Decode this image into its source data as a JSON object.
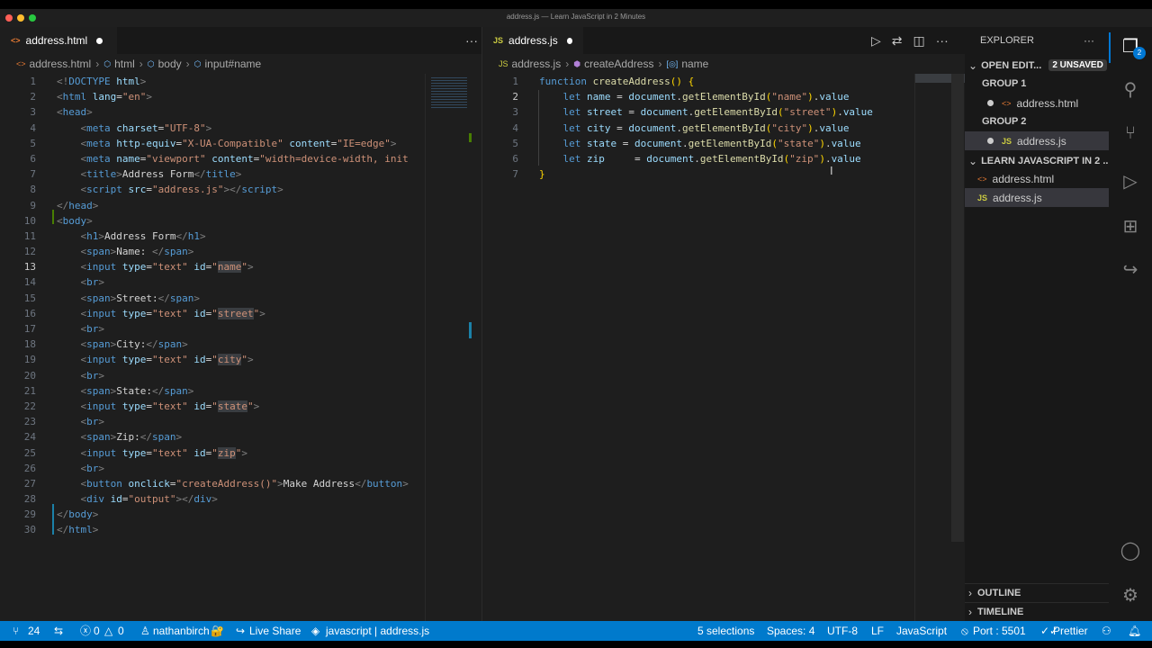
{
  "window": {
    "title": "address.js — Learn JavaScript in 2 Minutes",
    "colors": {
      "red": "#fe5f57",
      "yellow": "#febc2e",
      "green": "#28c840"
    }
  },
  "left_editor": {
    "tab_label": "address.html",
    "tab_icon": "html-file-icon",
    "more": "···",
    "breadcrumb": [
      "address.html",
      "html",
      "body",
      "input#name"
    ],
    "lines": [
      [
        [
          "t-gray",
          "<!"
        ],
        [
          "t-tag",
          "DOCTYPE"
        ],
        [
          "t-attr",
          " html"
        ],
        [
          "t-gray",
          ">"
        ]
      ],
      [
        [
          "t-gray",
          "<"
        ],
        [
          "t-tag",
          "html"
        ],
        [
          "t-attr",
          " lang"
        ],
        [
          "t-text",
          "="
        ],
        [
          "t-str",
          "\"en\""
        ],
        [
          "t-gray",
          ">"
        ]
      ],
      [
        [
          "t-gray",
          "<"
        ],
        [
          "t-tag",
          "head"
        ],
        [
          "t-gray",
          ">"
        ]
      ],
      [
        [
          "t-text",
          "    "
        ],
        [
          "t-gray",
          "<"
        ],
        [
          "t-tag",
          "meta"
        ],
        [
          "t-attr",
          " charset"
        ],
        [
          "t-text",
          "="
        ],
        [
          "t-str",
          "\"UTF-8\""
        ],
        [
          "t-gray",
          ">"
        ]
      ],
      [
        [
          "t-text",
          "    "
        ],
        [
          "t-gray",
          "<"
        ],
        [
          "t-tag",
          "meta"
        ],
        [
          "t-attr",
          " http-equiv"
        ],
        [
          "t-text",
          "="
        ],
        [
          "t-str",
          "\"X-UA-Compatible\""
        ],
        [
          "t-attr",
          " content"
        ],
        [
          "t-text",
          "="
        ],
        [
          "t-str",
          "\"IE=edge\""
        ],
        [
          "t-gray",
          ">"
        ]
      ],
      [
        [
          "t-text",
          "    "
        ],
        [
          "t-gray",
          "<"
        ],
        [
          "t-tag",
          "meta"
        ],
        [
          "t-attr",
          " name"
        ],
        [
          "t-text",
          "="
        ],
        [
          "t-str",
          "\"viewport\""
        ],
        [
          "t-attr",
          " content"
        ],
        [
          "t-text",
          "="
        ],
        [
          "t-str",
          "\"width=device-width, init"
        ]
      ],
      [
        [
          "t-text",
          "    "
        ],
        [
          "t-gray",
          "<"
        ],
        [
          "t-tag",
          "title"
        ],
        [
          "t-gray",
          ">"
        ],
        [
          "t-text",
          "Address Form"
        ],
        [
          "t-gray",
          "</"
        ],
        [
          "t-tag",
          "title"
        ],
        [
          "t-gray",
          ">"
        ]
      ],
      [
        [
          "t-text",
          "    "
        ],
        [
          "t-gray",
          "<"
        ],
        [
          "t-tag",
          "script"
        ],
        [
          "t-attr",
          " src"
        ],
        [
          "t-text",
          "="
        ],
        [
          "t-str",
          "\"address.js\""
        ],
        [
          "t-gray",
          "></"
        ],
        [
          "t-tag",
          "script"
        ],
        [
          "t-gray",
          ">"
        ]
      ],
      [
        [
          "t-gray",
          "</"
        ],
        [
          "t-tag",
          "head"
        ],
        [
          "t-gray",
          ">"
        ]
      ],
      [
        [
          "t-gray",
          "<"
        ],
        [
          "t-tag",
          "body"
        ],
        [
          "t-gray",
          ">"
        ]
      ],
      [
        [
          "t-text",
          "    "
        ],
        [
          "t-gray",
          "<"
        ],
        [
          "t-tag",
          "h1"
        ],
        [
          "t-gray",
          ">"
        ],
        [
          "t-text",
          "Address Form"
        ],
        [
          "t-gray",
          "</"
        ],
        [
          "t-tag",
          "h1"
        ],
        [
          "t-gray",
          ">"
        ]
      ],
      [
        [
          "t-text",
          "    "
        ],
        [
          "t-gray",
          "<"
        ],
        [
          "t-tag",
          "span"
        ],
        [
          "t-gray",
          ">"
        ],
        [
          "t-text",
          "Name: "
        ],
        [
          "t-gray",
          "</"
        ],
        [
          "t-tag",
          "span"
        ],
        [
          "t-gray",
          ">"
        ]
      ],
      [
        [
          "t-text",
          "    "
        ],
        [
          "t-gray",
          "<"
        ],
        [
          "t-tag",
          "input"
        ],
        [
          "t-attr",
          " type"
        ],
        [
          "t-text",
          "="
        ],
        [
          "t-str",
          "\"text\""
        ],
        [
          "t-attr",
          " id"
        ],
        [
          "t-text",
          "="
        ],
        [
          "t-str",
          "\""
        ],
        [
          "t-str hl",
          "name"
        ],
        [
          "t-str",
          "\""
        ],
        [
          "t-gray",
          ">"
        ]
      ],
      [
        [
          "t-text",
          "    "
        ],
        [
          "t-gray",
          "<"
        ],
        [
          "t-tag",
          "br"
        ],
        [
          "t-gray",
          ">"
        ]
      ],
      [
        [
          "t-text",
          "    "
        ],
        [
          "t-gray",
          "<"
        ],
        [
          "t-tag",
          "span"
        ],
        [
          "t-gray",
          ">"
        ],
        [
          "t-text",
          "Street:"
        ],
        [
          "t-gray",
          "</"
        ],
        [
          "t-tag",
          "span"
        ],
        [
          "t-gray",
          ">"
        ]
      ],
      [
        [
          "t-text",
          "    "
        ],
        [
          "t-gray",
          "<"
        ],
        [
          "t-tag",
          "input"
        ],
        [
          "t-attr",
          " type"
        ],
        [
          "t-text",
          "="
        ],
        [
          "t-str",
          "\"text\""
        ],
        [
          "t-attr",
          " id"
        ],
        [
          "t-text",
          "="
        ],
        [
          "t-str",
          "\""
        ],
        [
          "t-str hl",
          "street"
        ],
        [
          "t-str",
          "\""
        ],
        [
          "t-gray",
          ">"
        ]
      ],
      [
        [
          "t-text",
          "    "
        ],
        [
          "t-gray",
          "<"
        ],
        [
          "t-tag",
          "br"
        ],
        [
          "t-gray",
          ">"
        ]
      ],
      [
        [
          "t-text",
          "    "
        ],
        [
          "t-gray",
          "<"
        ],
        [
          "t-tag",
          "span"
        ],
        [
          "t-gray",
          ">"
        ],
        [
          "t-text",
          "City:"
        ],
        [
          "t-gray",
          "</"
        ],
        [
          "t-tag",
          "span"
        ],
        [
          "t-gray",
          ">"
        ]
      ],
      [
        [
          "t-text",
          "    "
        ],
        [
          "t-gray",
          "<"
        ],
        [
          "t-tag",
          "input"
        ],
        [
          "t-attr",
          " type"
        ],
        [
          "t-text",
          "="
        ],
        [
          "t-str",
          "\"text\""
        ],
        [
          "t-attr",
          " id"
        ],
        [
          "t-text",
          "="
        ],
        [
          "t-str",
          "\""
        ],
        [
          "t-str hl",
          "city"
        ],
        [
          "t-str",
          "\""
        ],
        [
          "t-gray",
          ">"
        ]
      ],
      [
        [
          "t-text",
          "    "
        ],
        [
          "t-gray",
          "<"
        ],
        [
          "t-tag",
          "br"
        ],
        [
          "t-gray",
          ">"
        ]
      ],
      [
        [
          "t-text",
          "    "
        ],
        [
          "t-gray",
          "<"
        ],
        [
          "t-tag",
          "span"
        ],
        [
          "t-gray",
          ">"
        ],
        [
          "t-text",
          "State:"
        ],
        [
          "t-gray",
          "</"
        ],
        [
          "t-tag",
          "span"
        ],
        [
          "t-gray",
          ">"
        ]
      ],
      [
        [
          "t-text",
          "    "
        ],
        [
          "t-gray",
          "<"
        ],
        [
          "t-tag",
          "input"
        ],
        [
          "t-attr",
          " type"
        ],
        [
          "t-text",
          "="
        ],
        [
          "t-str",
          "\"text\""
        ],
        [
          "t-attr",
          " id"
        ],
        [
          "t-text",
          "="
        ],
        [
          "t-str",
          "\""
        ],
        [
          "t-str hl",
          "state"
        ],
        [
          "t-str",
          "\""
        ],
        [
          "t-gray",
          ">"
        ]
      ],
      [
        [
          "t-text",
          "    "
        ],
        [
          "t-gray",
          "<"
        ],
        [
          "t-tag",
          "br"
        ],
        [
          "t-gray",
          ">"
        ]
      ],
      [
        [
          "t-text",
          "    "
        ],
        [
          "t-gray",
          "<"
        ],
        [
          "t-tag",
          "span"
        ],
        [
          "t-gray",
          ">"
        ],
        [
          "t-text",
          "Zip:"
        ],
        [
          "t-gray",
          "</"
        ],
        [
          "t-tag",
          "span"
        ],
        [
          "t-gray",
          ">"
        ]
      ],
      [
        [
          "t-text",
          "    "
        ],
        [
          "t-gray",
          "<"
        ],
        [
          "t-tag",
          "input"
        ],
        [
          "t-attr",
          " type"
        ],
        [
          "t-text",
          "="
        ],
        [
          "t-str",
          "\"text\""
        ],
        [
          "t-attr",
          " id"
        ],
        [
          "t-text",
          "="
        ],
        [
          "t-str",
          "\""
        ],
        [
          "t-str hl",
          "zip"
        ],
        [
          "t-str",
          "\""
        ],
        [
          "t-gray",
          ">"
        ]
      ],
      [
        [
          "t-text",
          "    "
        ],
        [
          "t-gray",
          "<"
        ],
        [
          "t-tag",
          "br"
        ],
        [
          "t-gray",
          ">"
        ]
      ],
      [
        [
          "t-text",
          "    "
        ],
        [
          "t-gray",
          "<"
        ],
        [
          "t-tag",
          "button"
        ],
        [
          "t-attr",
          " onclick"
        ],
        [
          "t-text",
          "="
        ],
        [
          "t-str",
          "\"createAddress()\""
        ],
        [
          "t-gray",
          ">"
        ],
        [
          "t-text",
          "Make Address"
        ],
        [
          "t-gray",
          "</"
        ],
        [
          "t-tag",
          "button"
        ],
        [
          "t-gray",
          ">"
        ]
      ],
      [
        [
          "t-text",
          "    "
        ],
        [
          "t-gray",
          "<"
        ],
        [
          "t-tag",
          "div"
        ],
        [
          "t-attr",
          " id"
        ],
        [
          "t-text",
          "="
        ],
        [
          "t-str",
          "\"output\""
        ],
        [
          "t-gray",
          "></"
        ],
        [
          "t-tag",
          "div"
        ],
        [
          "t-gray",
          ">"
        ]
      ],
      [
        [
          "t-gray",
          "</"
        ],
        [
          "t-tag",
          "body"
        ],
        [
          "t-gray",
          ">"
        ]
      ],
      [
        [
          "t-gray",
          "</"
        ],
        [
          "t-tag",
          "html"
        ],
        [
          "t-gray",
          ">"
        ]
      ]
    ],
    "current_line": 13
  },
  "right_editor": {
    "tab_label": "address.js",
    "tab_icon_text": "JS",
    "breadcrumb": [
      "address.js",
      "createAddress",
      "name"
    ],
    "actions": [
      "run-icon",
      "compare-icon",
      "split-editor-icon",
      "more-icon"
    ],
    "lines": [
      [
        [
          "t-kw",
          "function"
        ],
        [
          "t-text",
          " "
        ],
        [
          "t-fn",
          "createAddress"
        ],
        [
          "t-br",
          "()"
        ],
        [
          "t-text",
          " "
        ],
        [
          "t-br",
          "{"
        ]
      ],
      [
        [
          "t-text",
          "    "
        ],
        [
          "t-kw",
          "let"
        ],
        [
          "t-text",
          " "
        ],
        [
          "t-var",
          "name"
        ],
        [
          "t-text",
          " = "
        ],
        [
          "t-var",
          "document"
        ],
        [
          "t-text",
          "."
        ],
        [
          "t-fn",
          "getElementById"
        ],
        [
          "t-br",
          "("
        ],
        [
          "t-str",
          "\"name\""
        ],
        [
          "t-br",
          ")"
        ],
        [
          "t-text",
          "."
        ],
        [
          "t-var",
          "value"
        ]
      ],
      [
        [
          "t-text",
          "    "
        ],
        [
          "t-kw",
          "let"
        ],
        [
          "t-text",
          " "
        ],
        [
          "t-var",
          "street"
        ],
        [
          "t-text",
          " = "
        ],
        [
          "t-var",
          "document"
        ],
        [
          "t-text",
          "."
        ],
        [
          "t-fn",
          "getElementById"
        ],
        [
          "t-br",
          "("
        ],
        [
          "t-str",
          "\"street\""
        ],
        [
          "t-br",
          ")"
        ],
        [
          "t-text",
          "."
        ],
        [
          "t-var",
          "value"
        ]
      ],
      [
        [
          "t-text",
          "    "
        ],
        [
          "t-kw",
          "let"
        ],
        [
          "t-text",
          " "
        ],
        [
          "t-var",
          "city"
        ],
        [
          "t-text",
          " = "
        ],
        [
          "t-var",
          "document"
        ],
        [
          "t-text",
          "."
        ],
        [
          "t-fn",
          "getElementById"
        ],
        [
          "t-br",
          "("
        ],
        [
          "t-str",
          "\"city\""
        ],
        [
          "t-br",
          ")"
        ],
        [
          "t-text",
          "."
        ],
        [
          "t-var",
          "value"
        ]
      ],
      [
        [
          "t-text",
          "    "
        ],
        [
          "t-kw",
          "let"
        ],
        [
          "t-text",
          " "
        ],
        [
          "t-var",
          "state"
        ],
        [
          "t-text",
          " = "
        ],
        [
          "t-var",
          "document"
        ],
        [
          "t-text",
          "."
        ],
        [
          "t-fn",
          "getElementById"
        ],
        [
          "t-br",
          "("
        ],
        [
          "t-str",
          "\"state\""
        ],
        [
          "t-br",
          ")"
        ],
        [
          "t-text",
          "."
        ],
        [
          "t-var",
          "value"
        ]
      ],
      [
        [
          "t-text",
          "    "
        ],
        [
          "t-kw",
          "let"
        ],
        [
          "t-text",
          " "
        ],
        [
          "t-var",
          "zip"
        ],
        [
          "t-text",
          "     = "
        ],
        [
          "t-var",
          "document"
        ],
        [
          "t-text",
          "."
        ],
        [
          "t-fn",
          "getElementById"
        ],
        [
          "t-br",
          "("
        ],
        [
          "t-str",
          "\"zip\""
        ],
        [
          "t-br",
          ")"
        ],
        [
          "t-text",
          "."
        ],
        [
          "t-var",
          "value"
        ]
      ],
      [
        [
          "t-br",
          "}"
        ]
      ]
    ],
    "current_line": 2
  },
  "explorer": {
    "title": "EXPLORER",
    "more": "···",
    "open_editors": "OPEN EDIT...",
    "unsaved": "2 UNSAVED",
    "group1": "GROUP 1",
    "group1_file": "address.html",
    "group2": "GROUP 2",
    "group2_file": "address.js",
    "project": "LEARN JAVASCRIPT IN 2 ...",
    "files": [
      "address.html",
      "address.js"
    ],
    "outline": "OUTLINE",
    "timeline": "TIMELINE"
  },
  "activity_bar": {
    "items": [
      "explorer-icon",
      "search-icon",
      "source-control-icon",
      "run-debug-icon",
      "extensions-icon",
      "live-share-icon"
    ],
    "explorer_badge": "2",
    "bottom": [
      "account-icon",
      "settings-gear-icon"
    ]
  },
  "status_bar": {
    "branch_count": "24",
    "errors": "0",
    "warnings": "0",
    "user": "nathanbirch",
    "live_share": "Live Share",
    "language_hint": "javascript | address.js",
    "selections": "5 selections",
    "spaces": "Spaces: 4",
    "encoding": "UTF-8",
    "eol": "LF",
    "language": "JavaScript",
    "port": "Port : 5501",
    "prettier": "Prettier"
  }
}
